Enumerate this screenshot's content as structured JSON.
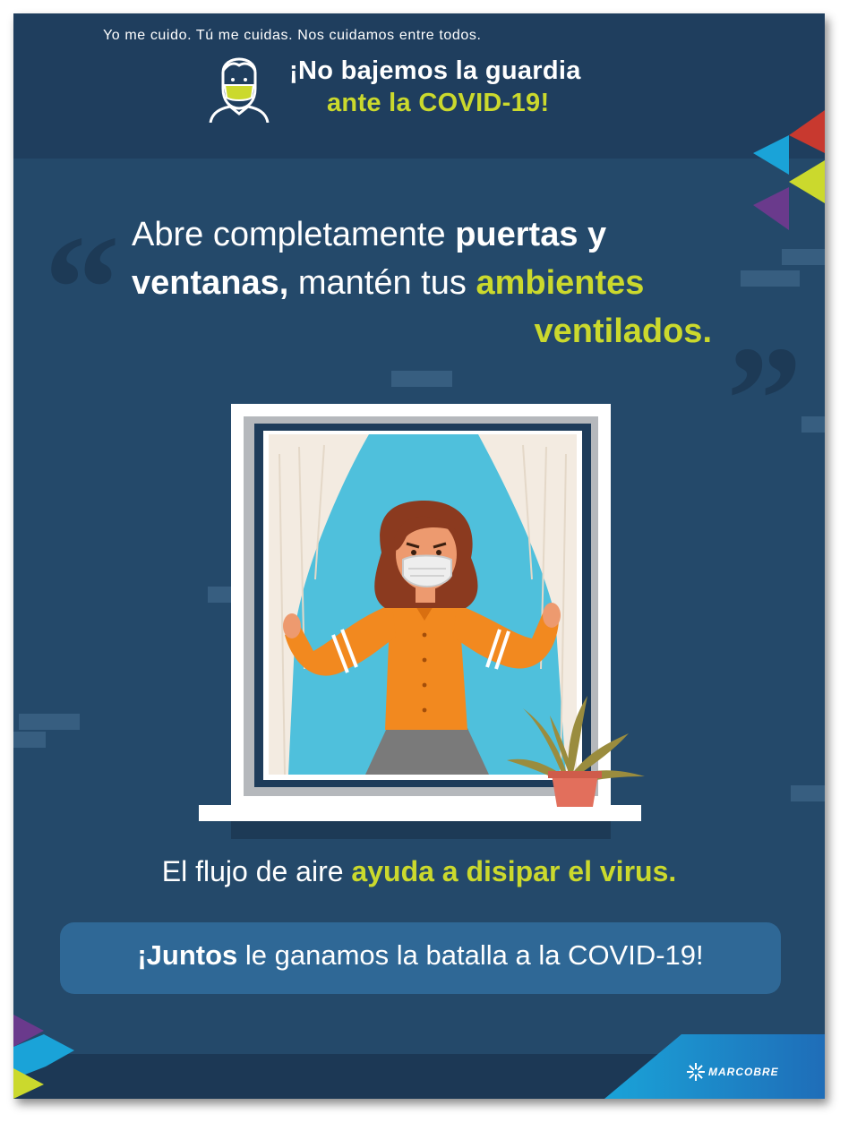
{
  "header": {
    "title_line1": "¡No bajemos la guardia",
    "title_line2": "ante la COVID-19!"
  },
  "message": {
    "part1": "Abre completamente ",
    "part2_bold": "puertas y",
    "part3_bold": "ventanas,",
    "part4": " mantén tus ",
    "part5_green": "ambientes",
    "part6_green": "ventilados."
  },
  "subline": {
    "normal": "El flujo de aire ",
    "highlight": "ayuda a disipar el virus."
  },
  "banner": {
    "bold": "¡Juntos",
    "rest": " le ganamos la batalla a la COVID-19!"
  },
  "footer": {
    "tagline": "Yo me cuido. Tú me cuidas. Nos cuidamos entre todos.",
    "brand": "MARCOBRE"
  },
  "colors": {
    "background": "#24496a",
    "header": "#1f3e5e",
    "accent_green": "#cbd92d",
    "banner": "#2f6896",
    "shirt": "#f2891f",
    "sky": "#4fc0dc"
  },
  "icons": [
    "masked-person-icon",
    "marcobre-logo-icon",
    "quote-open-icon",
    "quote-close-icon"
  ]
}
